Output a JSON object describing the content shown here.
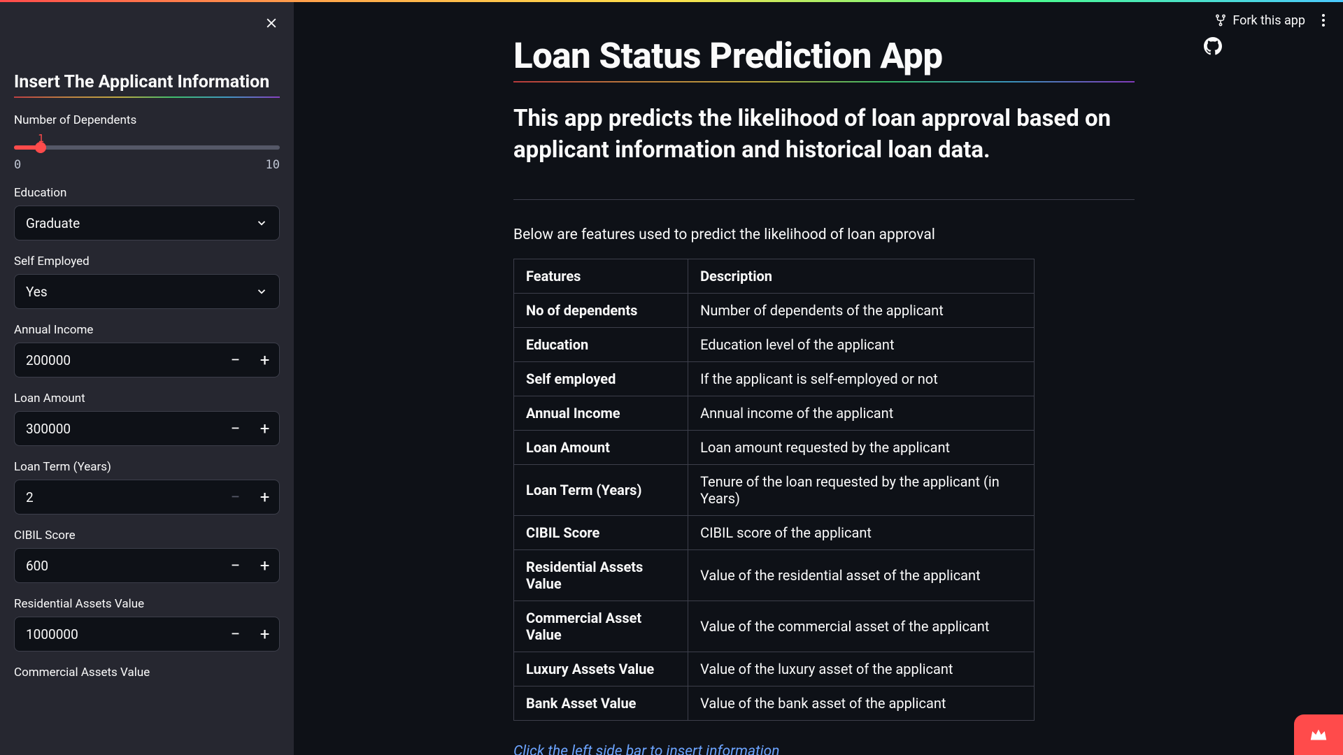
{
  "header": {
    "fork_label": "Fork this app"
  },
  "sidebar": {
    "title": "Insert The Applicant Information",
    "slider": {
      "label": "Number of Dependents",
      "value": "1",
      "min": "0",
      "max": "10",
      "percent": 10
    },
    "education": {
      "label": "Education",
      "value": "Graduate"
    },
    "self_employed": {
      "label": "Self Employed",
      "value": "Yes"
    },
    "annual_income": {
      "label": "Annual Income",
      "value": "200000"
    },
    "loan_amount": {
      "label": "Loan Amount",
      "value": "300000"
    },
    "loan_term": {
      "label": "Loan Term (Years)",
      "value": "2",
      "minus_disabled": true
    },
    "cibil": {
      "label": "CIBIL Score",
      "value": "600"
    },
    "res_assets": {
      "label": "Residential Assets Value",
      "value": "1000000"
    },
    "com_assets": {
      "label": "Commercial Assets Value"
    }
  },
  "main": {
    "title": "Loan Status Prediction App",
    "subtitle": "This app predicts the likelihood of loan approval based on applicant information and historical loan data.",
    "intro": "Below are features used to predict the likelihood of loan approval",
    "table_headers": {
      "c1": "Features",
      "c2": "Description"
    },
    "rows": [
      {
        "f": "No of dependents",
        "d": "Number of dependents of the applicant"
      },
      {
        "f": "Education",
        "d": "Education level of the applicant"
      },
      {
        "f": "Self employed",
        "d": "If the applicant is self-employed or not"
      },
      {
        "f": "Annual Income",
        "d": "Annual income of the applicant"
      },
      {
        "f": "Loan Amount",
        "d": "Loan amount requested by the applicant"
      },
      {
        "f": "Loan Term (Years)",
        "d": "Tenure of the loan requested by the applicant (in Years)"
      },
      {
        "f": "CIBIL Score",
        "d": "CIBIL score of the applicant"
      },
      {
        "f": "Residential Assets Value",
        "d": "Value of the residential asset of the applicant"
      },
      {
        "f": "Commercial Asset Value",
        "d": "Value of the commercial asset of the applicant"
      },
      {
        "f": "Luxury Assets Value",
        "d": "Value of the luxury asset of the applicant"
      },
      {
        "f": "Bank Asset Value",
        "d": "Value of the bank asset of the applicant"
      }
    ],
    "hint": "Click the left side bar to insert information"
  }
}
